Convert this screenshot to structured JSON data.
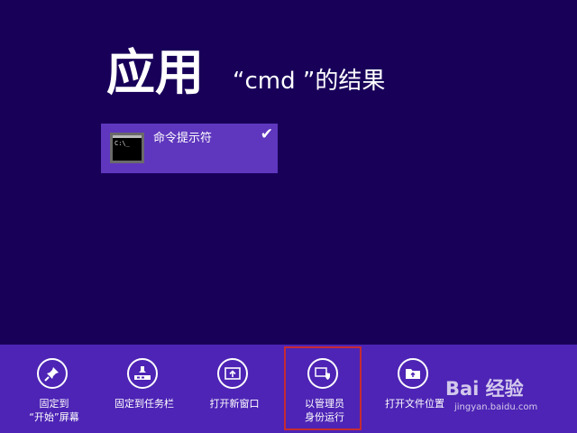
{
  "header": {
    "title": "应用",
    "subtitle": "“cmd ”的结果"
  },
  "results": [
    {
      "label": "命令提示符",
      "icon": "command-prompt-icon",
      "selected": true,
      "icon_text": "C:\\_"
    }
  ],
  "appbar": {
    "commands": [
      {
        "label": "固定到\n“开始”屏幕",
        "icon": "pin-icon"
      },
      {
        "label": "固定到任务栏",
        "icon": "taskbar-pin-icon"
      },
      {
        "label": "打开新窗口",
        "icon": "new-window-icon"
      },
      {
        "label": "以管理员\n身份运行",
        "icon": "admin-shield-icon",
        "highlighted": true
      },
      {
        "label": "打开文件位置",
        "icon": "folder-open-icon"
      }
    ]
  },
  "watermark": {
    "logo": "Bai 经验",
    "url": "jingyan.baidu.com"
  },
  "colors": {
    "background": "#180059",
    "tile": "#5f37be",
    "appbar": "#4d24b5",
    "highlight": "#c62b32"
  }
}
